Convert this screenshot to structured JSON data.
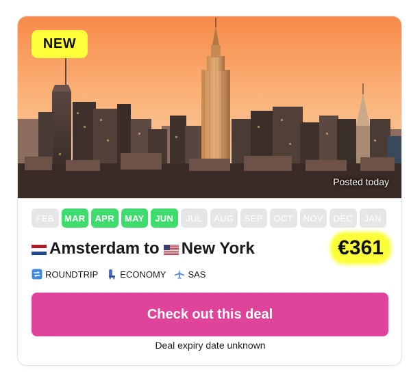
{
  "badge": {
    "label": "NEW"
  },
  "hero": {
    "posted": "Posted today",
    "scene": "new-york-skyline-sunset"
  },
  "months": [
    {
      "label": "FEB",
      "active": false
    },
    {
      "label": "MAR",
      "active": true
    },
    {
      "label": "APR",
      "active": true
    },
    {
      "label": "MAY",
      "active": true
    },
    {
      "label": "JUN",
      "active": true
    },
    {
      "label": "JUL",
      "active": false
    },
    {
      "label": "AUG",
      "active": false
    },
    {
      "label": "SEP",
      "active": false
    },
    {
      "label": "OCT",
      "active": false
    },
    {
      "label": "NOV",
      "active": false
    },
    {
      "label": "DEC",
      "active": false
    },
    {
      "label": "JAN",
      "active": false
    }
  ],
  "route": {
    "origin": "Amsterdam",
    "origin_flag": "netherlands-flag-icon",
    "connector": "to",
    "destination": "New York",
    "destination_flag": "usa-flag-icon"
  },
  "price": "€361",
  "meta": {
    "trip_type": "ROUNDTRIP",
    "cabin": "ECONOMY",
    "airline": "SAS"
  },
  "cta": {
    "label": "Check out this deal"
  },
  "expiry": "Deal expiry date unknown",
  "colors": {
    "active_month": "#3ddc6c",
    "inactive_month": "#e6e6e6",
    "cta": "#e0449a",
    "highlight": "#fbff3a"
  }
}
